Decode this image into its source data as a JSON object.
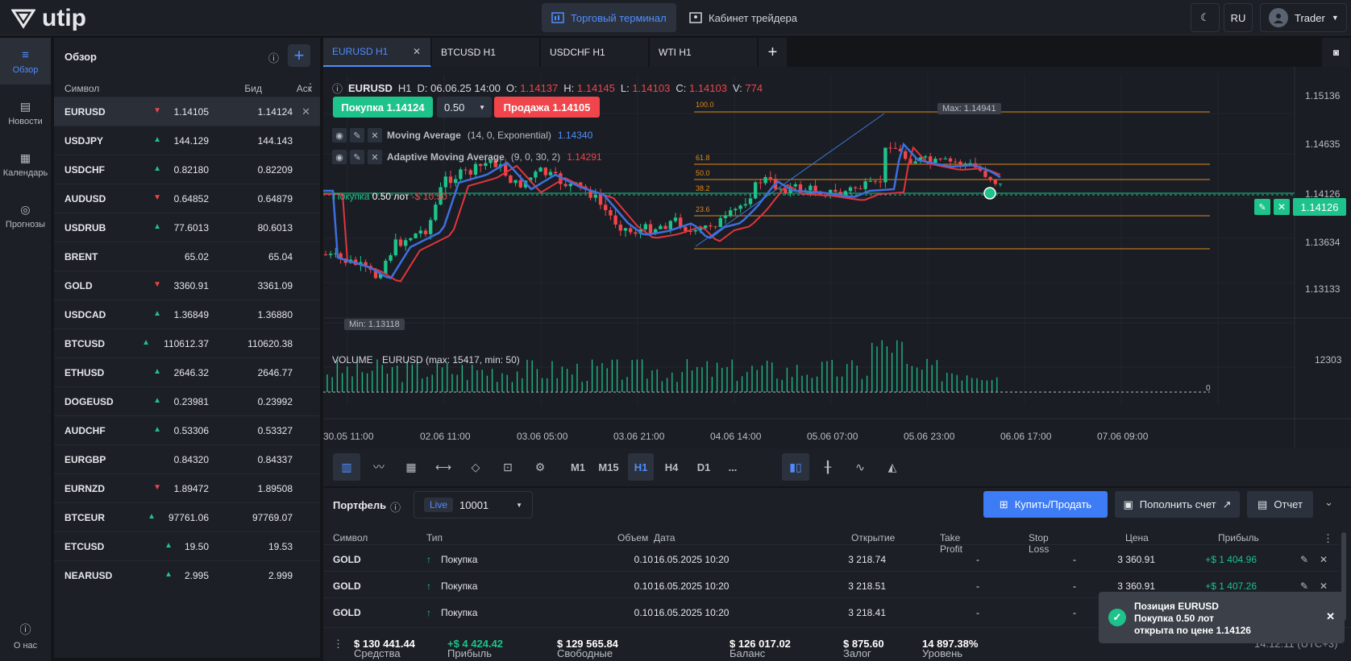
{
  "header": {
    "brand": "utip",
    "nav_terminal": "Торговый терминал",
    "nav_cabinet": "Кабинет трейдера",
    "lang": "RU",
    "user": "Trader"
  },
  "sidebar": {
    "items": [
      {
        "label": "Обзор",
        "icon": "list-icon"
      },
      {
        "label": "Новости",
        "icon": "news-icon"
      },
      {
        "label": "Календарь",
        "icon": "calendar-icon"
      },
      {
        "label": "Прогнозы",
        "icon": "forecast-icon"
      }
    ],
    "about": "О нас"
  },
  "overview": {
    "title": "Обзор",
    "col_symbol": "Символ",
    "col_bid": "Бид",
    "col_ask": "Аск",
    "rows": [
      {
        "symbol": "EURUSD",
        "bid": "1.14105",
        "ask": "1.14124",
        "dir": "down"
      },
      {
        "symbol": "USDJPY",
        "bid": "144.129",
        "ask": "144.143",
        "dir": "up"
      },
      {
        "symbol": "USDCHF",
        "bid": "0.82180",
        "ask": "0.82209",
        "dir": "up"
      },
      {
        "symbol": "AUDUSD",
        "bid": "0.64852",
        "ask": "0.64879",
        "dir": "down"
      },
      {
        "symbol": "USDRUB",
        "bid": "77.6013",
        "ask": "80.6013",
        "dir": "up"
      },
      {
        "symbol": "BRENT",
        "bid": "65.02",
        "ask": "65.04",
        "dir": ""
      },
      {
        "symbol": "GOLD",
        "bid": "3360.91",
        "ask": "3361.09",
        "dir": "down"
      },
      {
        "symbol": "USDCAD",
        "bid": "1.36849",
        "ask": "1.36880",
        "dir": "up"
      },
      {
        "symbol": "BTCUSD",
        "bid": "110612.37",
        "ask": "110620.38",
        "dir": "up"
      },
      {
        "symbol": "ETHUSD",
        "bid": "2646.32",
        "ask": "2646.77",
        "dir": "up"
      },
      {
        "symbol": "DOGEUSD",
        "bid": "0.23981",
        "ask": "0.23992",
        "dir": "up"
      },
      {
        "symbol": "AUDCHF",
        "bid": "0.53306",
        "ask": "0.53327",
        "dir": "up"
      },
      {
        "symbol": "EURGBP",
        "bid": "0.84320",
        "ask": "0.84337",
        "dir": ""
      },
      {
        "symbol": "EURNZD",
        "bid": "1.89472",
        "ask": "1.89508",
        "dir": "down"
      },
      {
        "symbol": "BTCEUR",
        "bid": "97761.06",
        "ask": "97769.07",
        "dir": "up"
      },
      {
        "symbol": "ETCUSD",
        "bid": "19.50",
        "ask": "19.53",
        "dir": "up"
      },
      {
        "symbol": "NEARUSD",
        "bid": "2.995",
        "ask": "2.999",
        "dir": "up"
      }
    ]
  },
  "tabs": [
    "EURUSD H1",
    "BTCUSD H1",
    "USDCHF H1",
    "WTI H1"
  ],
  "chart": {
    "symbol": "EURUSD",
    "tf": "H1",
    "d": "D: 06.06.25 14:00",
    "o_label": "O:",
    "o": "1.14137",
    "h_label": "H:",
    "h": "1.14145",
    "l_label": "L:",
    "l": "1.14103",
    "c_label": "C:",
    "c": "1.14103",
    "v_label": "V:",
    "v": "774",
    "buy_btn": "Покупка 1.14124",
    "lot": "0.50",
    "sell_btn": "Продажа 1.14105",
    "ind1_name": "Moving Average",
    "ind1_params": "(14, 0, Exponential)",
    "ind1_val": "1.14340",
    "ind2_name": "Adaptive Moving Average",
    "ind2_params": "(9, 0, 30, 2)",
    "ind2_val": "1.14291",
    "pos_label": "Покупка",
    "pos_lot": "0.50 лот",
    "pos_pnl": "-$ 10.50",
    "max_label": "Max: 1.14941",
    "min_label": "Min: 1.13118",
    "price_ticks": [
      "1.15136",
      "1.14635",
      "1.14126",
      "1.13634",
      "1.13133"
    ],
    "current_price": "1.14126",
    "fib": [
      "100.0",
      "61.8",
      "50.0",
      "38.2",
      "23.6"
    ],
    "volume_title": "VOLUME",
    "volume_info": "EURUSD (max: 15417, min: 50)",
    "volume_tick": "12303",
    "volume_zero": "0",
    "time_ticks": [
      "30.05 11:00",
      "02.06 11:00",
      "03.06 05:00",
      "03.06 21:00",
      "04.06 14:00",
      "05.06 07:00",
      "05.06 23:00",
      "06.06 17:00",
      "07.06 09:00"
    ],
    "timeframes": [
      "M1",
      "M15",
      "H1",
      "H4",
      "D1",
      "..."
    ],
    "active_tf": "H1"
  },
  "chart_data": {
    "type": "candlestick",
    "ylim": [
      1.128,
      1.153
    ],
    "min": 1.13118,
    "max": 1.14941,
    "last": 1.14126,
    "volume_max": 15417,
    "volume_min": 50
  },
  "portfolio": {
    "title": "Портфель",
    "mode": "Live",
    "account": "10001",
    "buy_sell": "Купить/Продать",
    "deposit": "Пополнить счет",
    "report": "Отчет",
    "cols": [
      "Символ",
      "Тип",
      "Объем",
      "Дата",
      "Открытие",
      "Take Profit",
      "Stop Loss",
      "Цена",
      "Прибыль"
    ],
    "rows": [
      {
        "symbol": "GOLD",
        "type": "Покупка",
        "vol": "0.10",
        "date": "16.05.2025 10:20",
        "open": "3 218.74",
        "tp": "-",
        "sl": "-",
        "price": "3 360.91",
        "profit": "+$ 1 404.96"
      },
      {
        "symbol": "GOLD",
        "type": "Покупка",
        "vol": "0.10",
        "date": "16.05.2025 10:20",
        "open": "3 218.51",
        "tp": "-",
        "sl": "-",
        "price": "3 360.91",
        "profit": "+$ 1 407.26"
      },
      {
        "symbol": "GOLD",
        "type": "Покупка",
        "vol": "0.10",
        "date": "16.05.2025 10:20",
        "open": "3 218.41",
        "tp": "-",
        "sl": "-",
        "price": "3 360.91",
        "profit": "+$ 1 408.26"
      }
    ]
  },
  "footer": {
    "funds_l": "Средства",
    "funds": "$ 130 441.44",
    "profit_l": "Прибыль",
    "profit": "+$ 4 424.42",
    "free_l": "Свободные",
    "free": "$ 129 565.84",
    "bal_l": "Баланс",
    "bal": "$ 126 017.02",
    "margin_l": "Залог",
    "margin": "$ 875.60",
    "level_l": "Уровень",
    "level": "14 897.38%",
    "time": "14:12:11 (UTC+3)"
  },
  "toast": {
    "line1": "Позиция EURUSD",
    "line2": "Покупка 0.50 лот",
    "line3": "открыта по цене 1.14126"
  }
}
